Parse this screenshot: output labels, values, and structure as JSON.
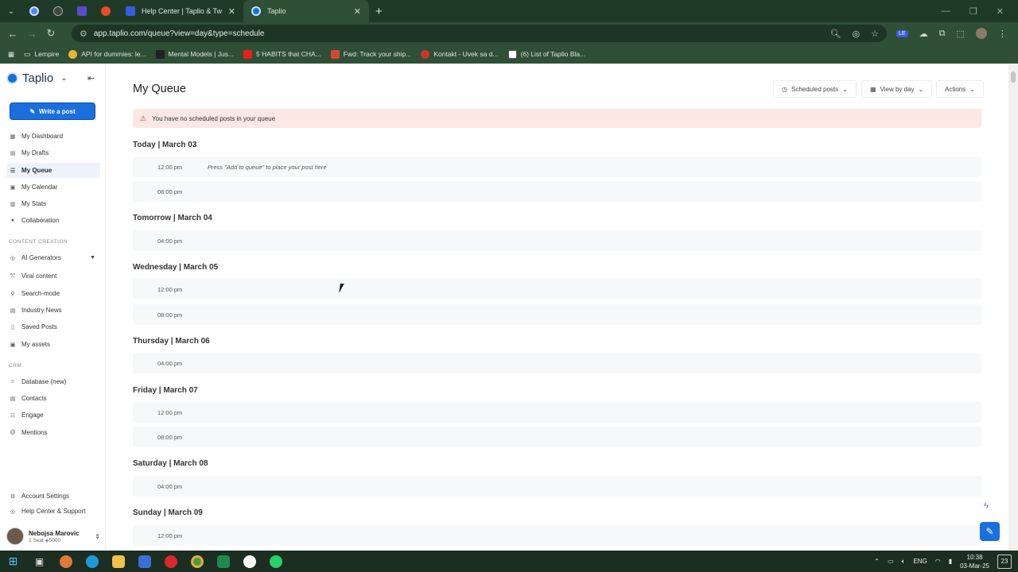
{
  "browser": {
    "tabs": [
      {
        "title": "Help Center | Taplio & Tweet H",
        "favicon": "taplio-help-icon"
      },
      {
        "title": "Taplio",
        "favicon": "taplio-icon"
      }
    ],
    "url": "app.taplio.com/queue?view=day&type=schedule",
    "bookmarks": [
      "Lempire",
      "API for dummies: le...",
      "Mental Models | Jus...",
      "5 HABITS that CHA...",
      "Fwd: Track your ship...",
      "Kontakt - Uvek sa d...",
      "(6) List of Taplio Bla..."
    ]
  },
  "sidebar": {
    "brand": "Taplio",
    "write_button": "Write a post",
    "nav": [
      {
        "label": "My Dashboard",
        "icon": "dashboard-icon"
      },
      {
        "label": "My Drafts",
        "icon": "drafts-icon"
      },
      {
        "label": "My Queue",
        "icon": "queue-icon",
        "active": true
      },
      {
        "label": "My Calendar",
        "icon": "calendar-icon"
      },
      {
        "label": "My Stats",
        "icon": "stats-icon"
      },
      {
        "label": "Collaboration",
        "icon": "collaboration-icon"
      }
    ],
    "content_creation_heading": "CONTENT CREATION",
    "content_creation": [
      {
        "label": "AI Generators",
        "icon": "ai-icon"
      },
      {
        "label": "Viral content",
        "icon": "viral-icon"
      },
      {
        "label": "Search-mode",
        "icon": "search-icon"
      },
      {
        "label": "Industry News",
        "icon": "news-icon"
      },
      {
        "label": "Saved Posts",
        "icon": "bookmark-icon"
      },
      {
        "label": "My assets",
        "icon": "assets-icon"
      }
    ],
    "crm_heading": "CRM",
    "crm": [
      {
        "label": "Database (new)",
        "icon": "database-icon"
      },
      {
        "label": "Contacts",
        "icon": "contacts-icon"
      },
      {
        "label": "Engage",
        "icon": "engage-icon"
      },
      {
        "label": "Mentions",
        "icon": "mentions-icon"
      }
    ],
    "account_settings": "Account Settings",
    "help_center": "Help Center & Support",
    "user": {
      "name": "Nebojsa Marovic",
      "seat": "1 Seat",
      "credits": "5000"
    }
  },
  "main": {
    "title": "My Queue",
    "scheduled_posts": "Scheduled posts",
    "view_by_day": "View by day",
    "actions": "Actions",
    "alert": "You have no scheduled posts in your queue",
    "days": [
      {
        "label": "Today | March 03",
        "slots": [
          {
            "time": "12:00 pm",
            "hint": "Press \"Add to queue\" to place your post here"
          },
          {
            "time": "08:00 pm"
          }
        ]
      },
      {
        "label": "Tomorrow | March 04",
        "slots": [
          {
            "time": "04:00 pm"
          }
        ]
      },
      {
        "label": "Wednesday | March 05",
        "slots": [
          {
            "time": "12:00 pm"
          },
          {
            "time": "08:00 pm"
          }
        ]
      },
      {
        "label": "Thursday | March 06",
        "slots": [
          {
            "time": "04:00 pm"
          }
        ]
      },
      {
        "label": "Friday | March 07",
        "slots": [
          {
            "time": "12:00 pm"
          },
          {
            "time": "08:00 pm"
          }
        ]
      },
      {
        "label": "Saturday | March 08",
        "slots": [
          {
            "time": "04:00 pm"
          }
        ]
      },
      {
        "label": "Sunday | March 09",
        "slots": [
          {
            "time": "12:00 pm"
          }
        ]
      }
    ]
  },
  "taskbar": {
    "lang": "ENG",
    "time": "10:38",
    "date": "03-Mar-25",
    "notifications": "23"
  },
  "colors": {
    "accent": "#1a6fdc",
    "chrome": "#2f4f37",
    "alert_bg": "#fbe7e3"
  }
}
